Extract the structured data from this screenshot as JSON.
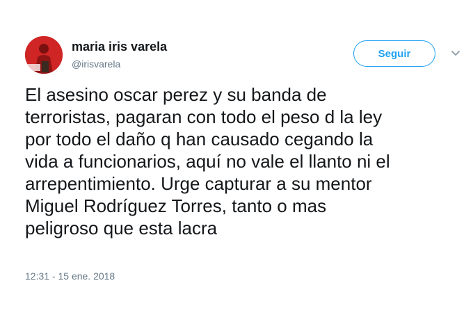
{
  "user": {
    "display_name": "maria iris varela",
    "handle": "@irisvarela"
  },
  "follow_button_label": "Seguir",
  "tweet_lines": [
    "El asesino oscar perez y su banda de",
    "terroristas, pagaran con todo el peso d la ley",
    "por todo el daño q han causado cegando la",
    "vida a funcionarios, aquí no vale el llanto ni el",
    "arrepentimiento. Urge capturar a su mentor",
    "Miguel Rodríguez Torres, tanto o mas",
    "peligroso que esta lacra"
  ],
  "timestamp": "12:31 - 15 ene. 2018",
  "icons": {
    "avatar": "profile-photo",
    "caret": "chevron-down-icon"
  },
  "colors": {
    "accent": "#1da1f2",
    "secondary_text": "#657786",
    "primary_text": "#14171a"
  }
}
